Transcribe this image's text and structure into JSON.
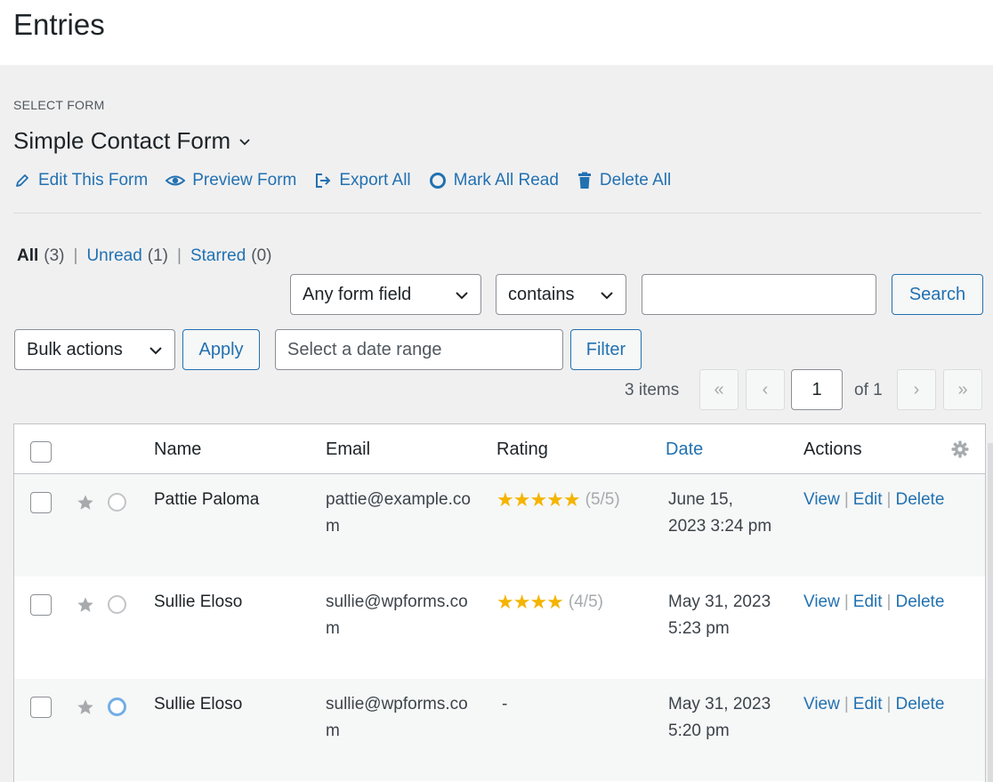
{
  "page": {
    "title": "Entries"
  },
  "form_selector": {
    "label": "SELECT FORM",
    "selected_form": "Simple Contact Form"
  },
  "form_actions": [
    {
      "label": "Edit This Form",
      "icon": "pencil-icon"
    },
    {
      "label": "Preview Form",
      "icon": "eye-icon"
    },
    {
      "label": "Export All",
      "icon": "export-icon"
    },
    {
      "label": "Mark All Read",
      "icon": "circle-icon"
    },
    {
      "label": "Delete All",
      "icon": "trash-icon"
    }
  ],
  "views": {
    "all": {
      "label": "All",
      "count": "(3)"
    },
    "unread": {
      "label": "Unread",
      "count": "(1)"
    },
    "starred": {
      "label": "Starred",
      "count": "(0)"
    },
    "separator": "|"
  },
  "search": {
    "field_select": "Any form field",
    "operator_select": "contains",
    "term_value": "",
    "button": "Search"
  },
  "bulk": {
    "select": "Bulk actions",
    "apply": "Apply"
  },
  "date_filter": {
    "placeholder": "Select a date range",
    "button": "Filter"
  },
  "pagination": {
    "items": "3 items",
    "first": "«",
    "prev": "‹",
    "current_page": "1",
    "of_total": "of 1",
    "next": "›",
    "last": "»"
  },
  "table": {
    "columns": {
      "name": "Name",
      "email": "Email",
      "rating": "Rating",
      "date": "Date",
      "actions": "Actions"
    },
    "action_labels": {
      "view": "View",
      "edit": "Edit",
      "delete": "Delete",
      "sep": "|"
    },
    "rows": [
      {
        "name": "Pattie Paloma",
        "email": "pattie@example.com",
        "rating_stars": "★★★★★",
        "rating_text": "(5/5)",
        "rating_value": 5,
        "date": "June 15, 2023 3:24 pm",
        "read": true,
        "starred": false
      },
      {
        "name": "Sullie Eloso",
        "email": "sullie@wpforms.com",
        "rating_stars": "★★★★",
        "rating_text": "(4/5)",
        "rating_value": 4,
        "date": "May 31, 2023 5:23 pm",
        "read": true,
        "starred": false
      },
      {
        "name": "Sullie Eloso",
        "email": "sullie@wpforms.com",
        "rating_stars": "",
        "rating_text": "-",
        "rating_value": null,
        "date": "May 31, 2023 5:20 pm",
        "read": false,
        "starred": false
      }
    ]
  },
  "colors": {
    "link": "#2271b1",
    "star_gold": "#f4b400",
    "unread_circle": "#72aee6",
    "background": "#f0f0f1"
  }
}
